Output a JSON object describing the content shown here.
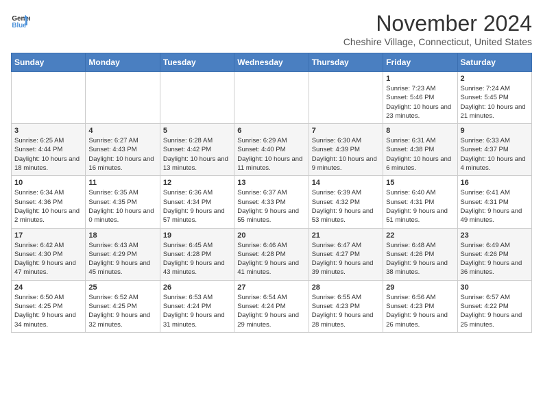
{
  "header": {
    "logo_line1": "General",
    "logo_line2": "Blue",
    "month": "November 2024",
    "location": "Cheshire Village, Connecticut, United States"
  },
  "weekdays": [
    "Sunday",
    "Monday",
    "Tuesday",
    "Wednesday",
    "Thursday",
    "Friday",
    "Saturday"
  ],
  "weeks": [
    [
      {
        "day": "",
        "info": ""
      },
      {
        "day": "",
        "info": ""
      },
      {
        "day": "",
        "info": ""
      },
      {
        "day": "",
        "info": ""
      },
      {
        "day": "",
        "info": ""
      },
      {
        "day": "1",
        "info": "Sunrise: 7:23 AM\nSunset: 5:46 PM\nDaylight: 10 hours and 23 minutes."
      },
      {
        "day": "2",
        "info": "Sunrise: 7:24 AM\nSunset: 5:45 PM\nDaylight: 10 hours and 21 minutes."
      }
    ],
    [
      {
        "day": "3",
        "info": "Sunrise: 6:25 AM\nSunset: 4:44 PM\nDaylight: 10 hours and 18 minutes."
      },
      {
        "day": "4",
        "info": "Sunrise: 6:27 AM\nSunset: 4:43 PM\nDaylight: 10 hours and 16 minutes."
      },
      {
        "day": "5",
        "info": "Sunrise: 6:28 AM\nSunset: 4:42 PM\nDaylight: 10 hours and 13 minutes."
      },
      {
        "day": "6",
        "info": "Sunrise: 6:29 AM\nSunset: 4:40 PM\nDaylight: 10 hours and 11 minutes."
      },
      {
        "day": "7",
        "info": "Sunrise: 6:30 AM\nSunset: 4:39 PM\nDaylight: 10 hours and 9 minutes."
      },
      {
        "day": "8",
        "info": "Sunrise: 6:31 AM\nSunset: 4:38 PM\nDaylight: 10 hours and 6 minutes."
      },
      {
        "day": "9",
        "info": "Sunrise: 6:33 AM\nSunset: 4:37 PM\nDaylight: 10 hours and 4 minutes."
      }
    ],
    [
      {
        "day": "10",
        "info": "Sunrise: 6:34 AM\nSunset: 4:36 PM\nDaylight: 10 hours and 2 minutes."
      },
      {
        "day": "11",
        "info": "Sunrise: 6:35 AM\nSunset: 4:35 PM\nDaylight: 10 hours and 0 minutes."
      },
      {
        "day": "12",
        "info": "Sunrise: 6:36 AM\nSunset: 4:34 PM\nDaylight: 9 hours and 57 minutes."
      },
      {
        "day": "13",
        "info": "Sunrise: 6:37 AM\nSunset: 4:33 PM\nDaylight: 9 hours and 55 minutes."
      },
      {
        "day": "14",
        "info": "Sunrise: 6:39 AM\nSunset: 4:32 PM\nDaylight: 9 hours and 53 minutes."
      },
      {
        "day": "15",
        "info": "Sunrise: 6:40 AM\nSunset: 4:31 PM\nDaylight: 9 hours and 51 minutes."
      },
      {
        "day": "16",
        "info": "Sunrise: 6:41 AM\nSunset: 4:31 PM\nDaylight: 9 hours and 49 minutes."
      }
    ],
    [
      {
        "day": "17",
        "info": "Sunrise: 6:42 AM\nSunset: 4:30 PM\nDaylight: 9 hours and 47 minutes."
      },
      {
        "day": "18",
        "info": "Sunrise: 6:43 AM\nSunset: 4:29 PM\nDaylight: 9 hours and 45 minutes."
      },
      {
        "day": "19",
        "info": "Sunrise: 6:45 AM\nSunset: 4:28 PM\nDaylight: 9 hours and 43 minutes."
      },
      {
        "day": "20",
        "info": "Sunrise: 6:46 AM\nSunset: 4:28 PM\nDaylight: 9 hours and 41 minutes."
      },
      {
        "day": "21",
        "info": "Sunrise: 6:47 AM\nSunset: 4:27 PM\nDaylight: 9 hours and 39 minutes."
      },
      {
        "day": "22",
        "info": "Sunrise: 6:48 AM\nSunset: 4:26 PM\nDaylight: 9 hours and 38 minutes."
      },
      {
        "day": "23",
        "info": "Sunrise: 6:49 AM\nSunset: 4:26 PM\nDaylight: 9 hours and 36 minutes."
      }
    ],
    [
      {
        "day": "24",
        "info": "Sunrise: 6:50 AM\nSunset: 4:25 PM\nDaylight: 9 hours and 34 minutes."
      },
      {
        "day": "25",
        "info": "Sunrise: 6:52 AM\nSunset: 4:25 PM\nDaylight: 9 hours and 32 minutes."
      },
      {
        "day": "26",
        "info": "Sunrise: 6:53 AM\nSunset: 4:24 PM\nDaylight: 9 hours and 31 minutes."
      },
      {
        "day": "27",
        "info": "Sunrise: 6:54 AM\nSunset: 4:24 PM\nDaylight: 9 hours and 29 minutes."
      },
      {
        "day": "28",
        "info": "Sunrise: 6:55 AM\nSunset: 4:23 PM\nDaylight: 9 hours and 28 minutes."
      },
      {
        "day": "29",
        "info": "Sunrise: 6:56 AM\nSunset: 4:23 PM\nDaylight: 9 hours and 26 minutes."
      },
      {
        "day": "30",
        "info": "Sunrise: 6:57 AM\nSunset: 4:22 PM\nDaylight: 9 hours and 25 minutes."
      }
    ]
  ]
}
